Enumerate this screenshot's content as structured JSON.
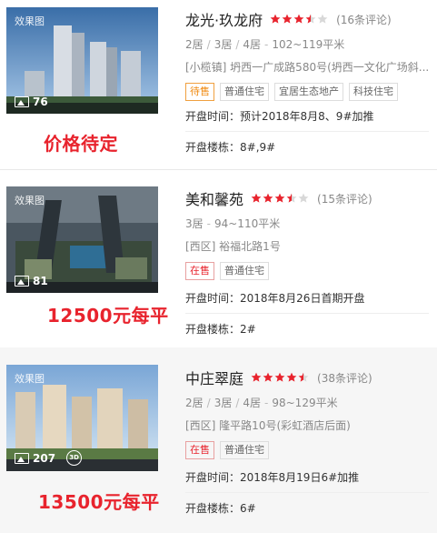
{
  "listings": [
    {
      "name": "龙光·玖龙府",
      "rating": 3.5,
      "reviews": "(16条评论)",
      "rooms": [
        "2居",
        "3居",
        "4居"
      ],
      "area": "102~119平米",
      "address": "[小榄镇] 坍西一广成路580号(坍西一文化广场斜...",
      "tags": [
        "待售",
        "普通住宅",
        "宜居生态地产",
        "科技住宅"
      ],
      "status_kind": "pending",
      "photo_count": "76",
      "effect_label": "效果图",
      "price": "价格待定",
      "open_time": "开盘时间：预计2018年8月8、9#加推",
      "buildings": "开盘楼栋：8#,9#"
    },
    {
      "name": "美和馨苑",
      "rating": 3.5,
      "reviews": "(15条评论)",
      "rooms": [
        "3居"
      ],
      "area": "94~110平米",
      "address": "[西区] 裕福北路1号",
      "tags": [
        "在售",
        "普通住宅"
      ],
      "status_kind": "sale",
      "photo_count": "81",
      "effect_label": "效果图",
      "price": "12500元每平",
      "open_time": "开盘时间：2018年8月26日首期开盘",
      "buildings": "开盘楼栋：2#"
    },
    {
      "name": "中庄翠庭",
      "rating": 4.5,
      "reviews": "(38条评论)",
      "rooms": [
        "2居",
        "3居",
        "4居"
      ],
      "area": "98~129平米",
      "address": "[西区] 隆平路10号(彩虹酒店后面)",
      "tags": [
        "在售",
        "普通住宅"
      ],
      "status_kind": "sale",
      "photo_count": "207",
      "effect_label": "效果图",
      "price": "13500元每平",
      "open_time": "开盘时间：2018年8月19日6#加推",
      "buildings": "开盘楼栋：6#"
    }
  ],
  "colors": {
    "price": "#e8232d",
    "star": "#e8232d",
    "star_empty": "#d8d8d8",
    "pending": "#f08a10"
  }
}
